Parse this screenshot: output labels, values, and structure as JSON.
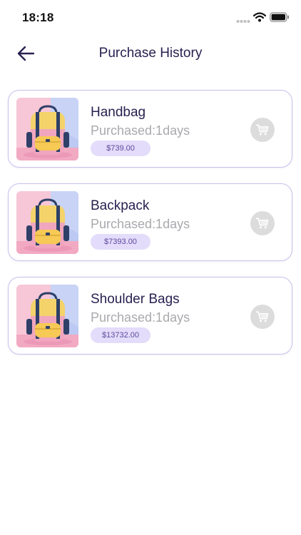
{
  "status_bar": {
    "time": "18:18"
  },
  "header": {
    "title": "Purchase History",
    "back_icon": "arrow-left-icon"
  },
  "orders": [
    {
      "name": "Handbag",
      "purchased": "Purchased:1days",
      "price": "$739.00",
      "image_icon": "backpack-image",
      "cart_icon": "cart-icon"
    },
    {
      "name": "Backpack",
      "purchased": "Purchased:1days",
      "price": "$7393.00",
      "image_icon": "backpack-image",
      "cart_icon": "cart-icon"
    },
    {
      "name": "Shoulder Bags",
      "purchased": "Purchased:1days",
      "price": "$13732.00",
      "image_icon": "backpack-image",
      "cart_icon": "cart-icon"
    }
  ],
  "colors": {
    "accent": "#2a2150",
    "card_border": "#c9c0ec",
    "badge_bg": "#e3dcfa",
    "badge_text": "#5d4a9e",
    "muted_text": "#a9a9ae",
    "cart_bg": "#dcdcdc"
  }
}
